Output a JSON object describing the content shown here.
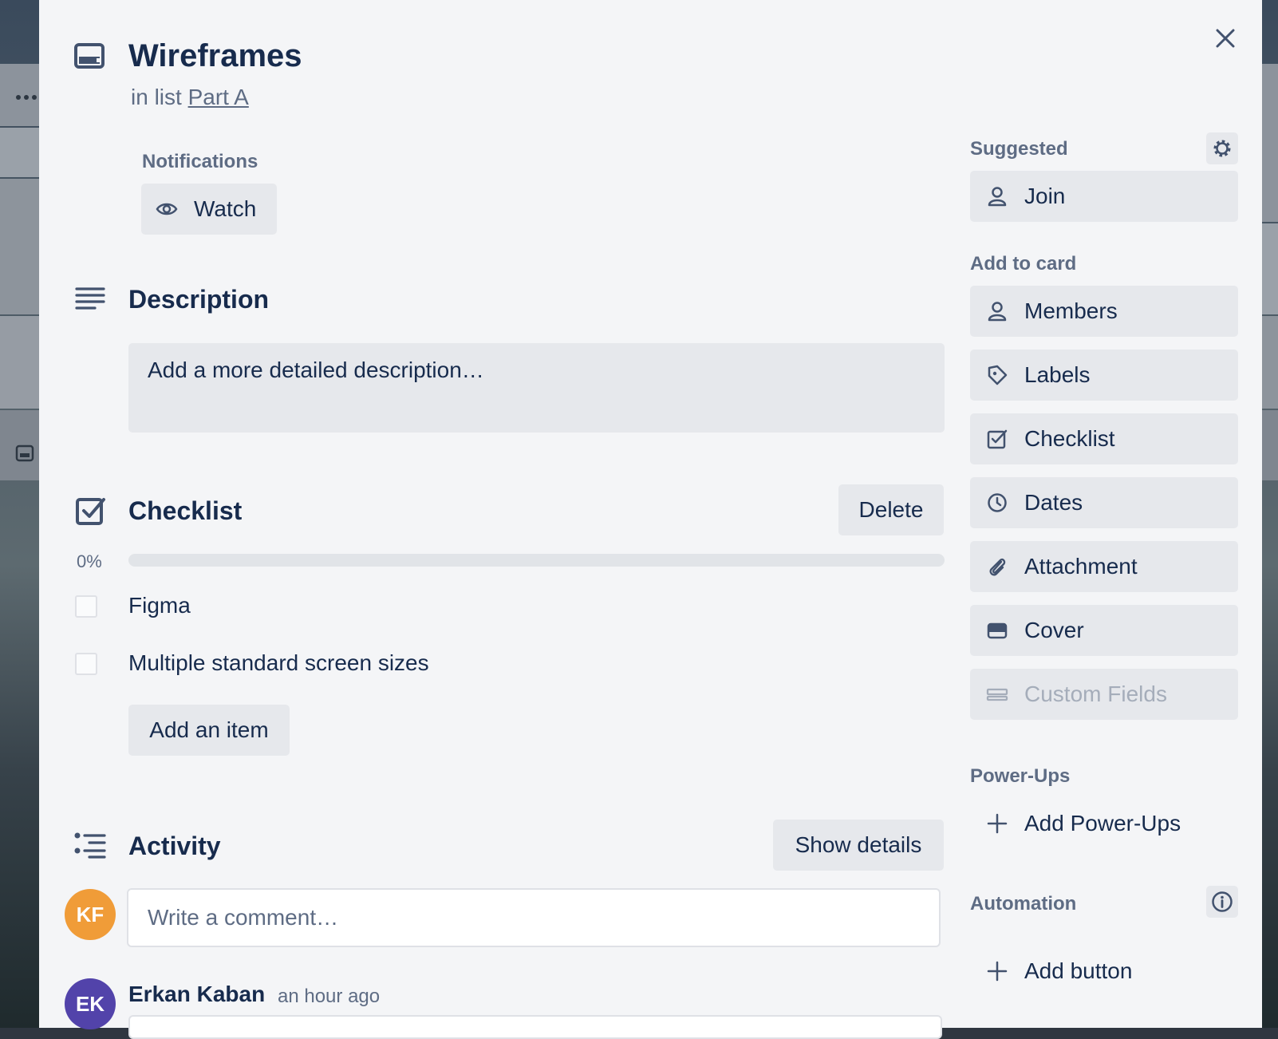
{
  "card": {
    "title": "Wireframes",
    "in_list_prefix": "in list",
    "list_name": "Part A"
  },
  "notifications": {
    "label": "Notifications",
    "watch_label": "Watch"
  },
  "description": {
    "title": "Description",
    "placeholder": "Add a more detailed description…"
  },
  "checklist": {
    "title": "Checklist",
    "delete_label": "Delete",
    "progress_text": "0%",
    "progress_value": 0,
    "items": [
      {
        "text": "Figma",
        "checked": false
      },
      {
        "text": "Multiple standard screen sizes",
        "checked": false
      }
    ],
    "add_item_label": "Add an item"
  },
  "activity": {
    "title": "Activity",
    "show_details_label": "Show details",
    "comment_placeholder": "Write a comment…",
    "current_user_initials": "KF",
    "entries": [
      {
        "initials": "EK",
        "author": "Erkan Kaban",
        "time": "an hour ago"
      }
    ]
  },
  "sidebar": {
    "suggested_label": "Suggested",
    "join_label": "Join",
    "add_to_card_label": "Add to card",
    "add_to_card": [
      {
        "label": "Members",
        "icon": "person-icon"
      },
      {
        "label": "Labels",
        "icon": "tag-icon"
      },
      {
        "label": "Checklist",
        "icon": "checkbox-icon"
      },
      {
        "label": "Dates",
        "icon": "clock-icon"
      },
      {
        "label": "Attachment",
        "icon": "paperclip-icon"
      },
      {
        "label": "Cover",
        "icon": "cover-icon"
      },
      {
        "label": "Custom Fields",
        "icon": "custom-fields-icon"
      }
    ],
    "powerups_label": "Power-Ups",
    "add_powerups_label": "Add Power-Ups",
    "automation_label": "Automation",
    "add_button_label": "Add button"
  },
  "colors": {
    "modal_bg": "#f4f5f7",
    "button_bg": "#e6e8ec",
    "text": "#172b4d",
    "muted": "#5e6c84",
    "avatar_kf": "#f09c38",
    "avatar_ek": "#5243aa"
  }
}
